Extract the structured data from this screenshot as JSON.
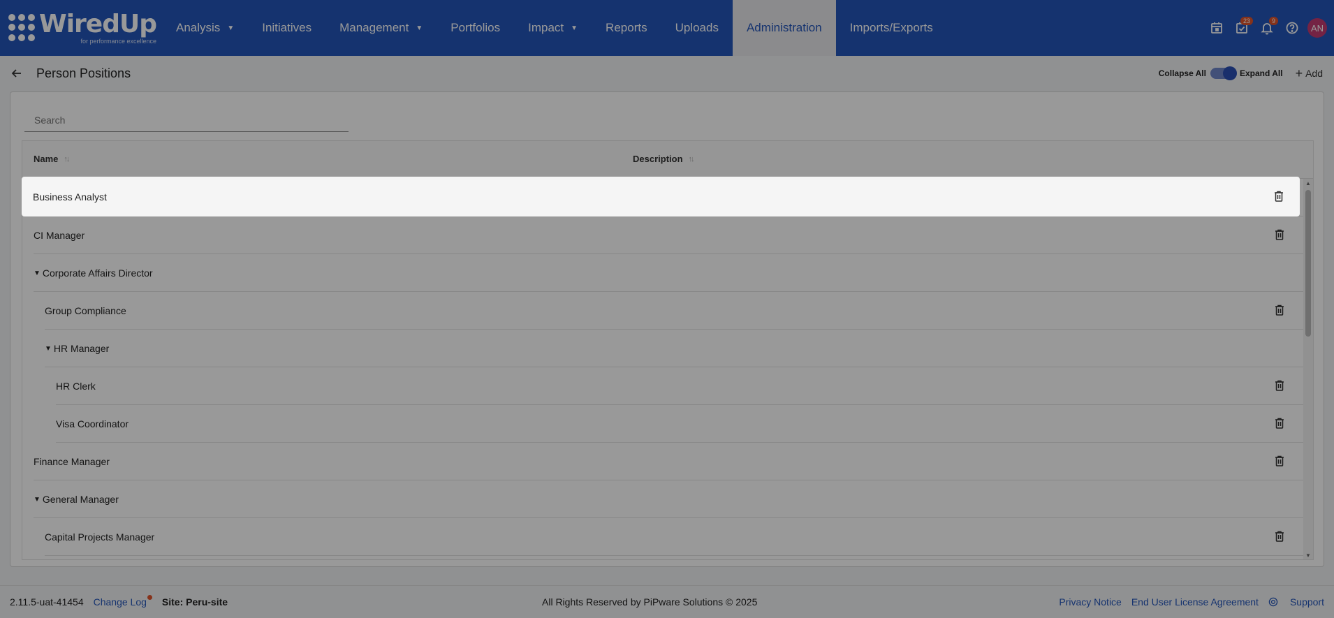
{
  "brand": {
    "name": "WiredUp",
    "tagline": "for performance excellence"
  },
  "nav": {
    "items": [
      {
        "label": "Analysis",
        "dropdown": true
      },
      {
        "label": "Initiatives",
        "dropdown": false
      },
      {
        "label": "Management",
        "dropdown": true
      },
      {
        "label": "Portfolios",
        "dropdown": false
      },
      {
        "label": "Impact",
        "dropdown": true
      },
      {
        "label": "Reports",
        "dropdown": false
      },
      {
        "label": "Uploads",
        "dropdown": false
      },
      {
        "label": "Administration",
        "dropdown": false,
        "active": true
      },
      {
        "label": "Imports/Exports",
        "dropdown": false
      }
    ]
  },
  "top_icons": {
    "calendar": {
      "icon": "calendar-icon"
    },
    "tasks": {
      "icon": "tasks-check-icon",
      "badge": "23"
    },
    "notifications": {
      "icon": "bell-icon",
      "badge": "9"
    },
    "help": {
      "icon": "help-icon"
    },
    "avatar_initials": "AN"
  },
  "page": {
    "title": "Person Positions",
    "collapse_all_label": "Collapse All",
    "expand_all_label": "Expand All",
    "add_label": "Add"
  },
  "search": {
    "placeholder": "Search",
    "value": ""
  },
  "table": {
    "columns": {
      "name": "Name",
      "description": "Description"
    },
    "rows": [
      {
        "name": "Business Analyst",
        "level": 0,
        "expandable": false,
        "deletable": true,
        "highlighted": true
      },
      {
        "name": "CI Manager",
        "level": 0,
        "expandable": false,
        "deletable": true
      },
      {
        "name": "Corporate Affairs Director",
        "level": 0,
        "expandable": true,
        "deletable": false
      },
      {
        "name": "Group Compliance",
        "level": 1,
        "expandable": false,
        "deletable": true
      },
      {
        "name": "HR Manager",
        "level": 1,
        "expandable": true,
        "deletable": false
      },
      {
        "name": "HR Clerk",
        "level": 2,
        "expandable": false,
        "deletable": true
      },
      {
        "name": "Visa Coordinator",
        "level": 2,
        "expandable": false,
        "deletable": true
      },
      {
        "name": "Finance Manager",
        "level": 0,
        "expandable": false,
        "deletable": true
      },
      {
        "name": "General Manager",
        "level": 0,
        "expandable": true,
        "deletable": false
      },
      {
        "name": "Capital Projects Manager",
        "level": 1,
        "expandable": false,
        "deletable": true
      }
    ]
  },
  "footer": {
    "version": "2.11.5-uat-41454",
    "change_log": "Change Log",
    "site": "Site: Peru-site",
    "copyright": "All Rights Reserved by PiPware Solutions © 2025",
    "privacy": "Privacy Notice",
    "eula": "End User License Agreement",
    "support": "Support"
  },
  "colors": {
    "brand_blue": "#2455b9",
    "badge": "#e0542c",
    "avatar": "#c23b72"
  }
}
